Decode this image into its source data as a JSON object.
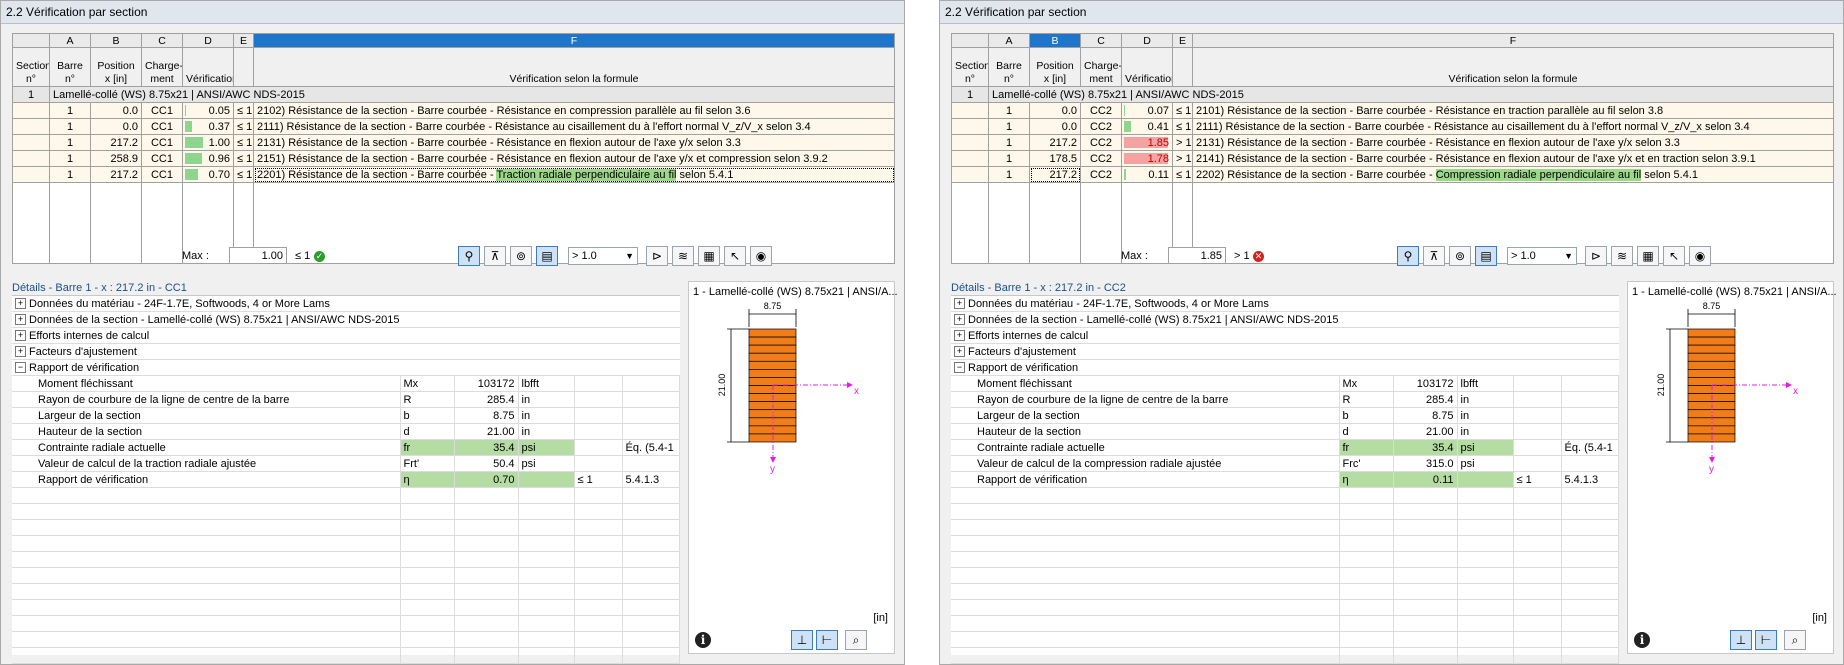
{
  "colors": {
    "selection": "#1f75c9",
    "ok_bar": "#8fd48f",
    "fail_bar": "#f4a3a3",
    "highlight": "#9bd889"
  },
  "columns": {
    "letters": [
      "A",
      "B",
      "C",
      "D",
      "E",
      "F"
    ],
    "section": "Section n°",
    "barre": "Barre n°",
    "position": "Position x [in]",
    "chargement": "Charge- ment",
    "verification": "Vérification",
    "formule": "Vérification selon la formule"
  },
  "window_a": {
    "title": "2.2  Vérification par section",
    "group": {
      "num": "1",
      "label": "Lamellé-collé (WS) 8.75x21 | ANSI/AWC NDS-2015"
    },
    "rows": [
      {
        "barre": "1",
        "x": "0.0",
        "load": "CC1",
        "ratio": 0.05,
        "ratio_text": "0.05",
        "le": "≤ 1",
        "text": "2102) Résistance de la section - Barre courbée - Résistance en compression parallèle au fil selon 3.6",
        "hl_pre": "",
        "hl": "",
        "hl_post": ""
      },
      {
        "barre": "1",
        "x": "0.0",
        "load": "CC1",
        "ratio": 0.37,
        "ratio_text": "0.37",
        "le": "≤ 1",
        "text": "2111) Résistance de la section - Barre courbée - Résistance au cisaillement du à l'effort normal V_z/V_x selon 3.4",
        "hl_pre": "",
        "hl": "",
        "hl_post": ""
      },
      {
        "barre": "1",
        "x": "217.2",
        "load": "CC1",
        "ratio": 1.0,
        "ratio_text": "1.00",
        "le": "≤ 1",
        "text": "2131) Résistance de la section - Barre courbée - Résistance en flexion autour de l'axe y/x selon 3.3",
        "hl_pre": "",
        "hl": "",
        "hl_post": ""
      },
      {
        "barre": "1",
        "x": "258.9",
        "load": "CC1",
        "ratio": 0.96,
        "ratio_text": "0.96",
        "le": "≤ 1",
        "text": "2151) Résistance de la section - Barre courbée - Résistance en flexion autour de l'axe y/x et compression selon 3.9.2",
        "hl_pre": "",
        "hl": "",
        "hl_post": ""
      },
      {
        "barre": "1",
        "x": "217.2",
        "load": "CC1",
        "ratio": 0.7,
        "ratio_text": "0.70",
        "le": "≤ 1",
        "text": "",
        "hl_pre": "2201) Résistance de la section - Barre courbée - ",
        "hl": "Traction radiale perpendiculaire au fil",
        "hl_post": " selon 5.4.1"
      }
    ],
    "max_label": "Max :",
    "max_value": "1.00",
    "max_cmp": "≤ 1",
    "filter": "> 1.0",
    "details_title": "Détails - Barre 1 - x : 217.2 in - CC1",
    "sections": [
      {
        "sign": "+",
        "label": "Données du matériau - 24F-1.7E, Softwoods, 4 or More Lams"
      },
      {
        "sign": "+",
        "label": "Données de la section - Lamellé-collé (WS) 8.75x21 | ANSI/AWC NDS-2015"
      },
      {
        "sign": "+",
        "label": "Efforts internes de calcul"
      },
      {
        "sign": "+",
        "label": "Facteurs d'ajustement"
      },
      {
        "sign": "−",
        "label": "Rapport de vérification"
      }
    ],
    "details": [
      {
        "name": "Moment fléchissant",
        "sym": "Mx",
        "val": "103172",
        "unit": "lbfft",
        "cmp": "",
        "ref": ""
      },
      {
        "name": "Rayon de courbure de la ligne de centre de la barre",
        "sym": "R",
        "val": "285.4",
        "unit": "in",
        "cmp": "",
        "ref": ""
      },
      {
        "name": "Largeur de la section",
        "sym": "b",
        "val": "8.75",
        "unit": "in",
        "cmp": "",
        "ref": ""
      },
      {
        "name": "Hauteur de la section",
        "sym": "d",
        "val": "21.00",
        "unit": "in",
        "cmp": "",
        "ref": ""
      },
      {
        "name": "Contrainte radiale actuelle",
        "sym": "fr",
        "val": "35.4",
        "unit": "psi",
        "cmp": "",
        "ref": "Éq. (5.4-1"
      },
      {
        "name": "Valeur de calcul de la traction radiale ajustée",
        "sym": "Frt'",
        "val": "50.4",
        "unit": "psi",
        "cmp": "",
        "ref": ""
      },
      {
        "name": "Rapport de vérification",
        "sym": "η",
        "val": "0.70",
        "unit": "",
        "cmp": "≤ 1",
        "ref": "5.4.1.3"
      }
    ],
    "preview_title": "1 - Lamellé-collé (WS) 8.75x21 | ANSI/A...",
    "dim_width": "8.75",
    "dim_height": "21.00",
    "axis_y": "y",
    "axis_x": "x",
    "unit": "[in]"
  },
  "window_b": {
    "title": "2.2  Vérification par section",
    "group": {
      "num": "1",
      "label": "Lamellé-collé (WS) 8.75x21 | ANSI/AWC NDS-2015"
    },
    "rows": [
      {
        "barre": "1",
        "x": "0.0",
        "load": "CC2",
        "ratio": 0.07,
        "ratio_text": "0.07",
        "le": "≤ 1",
        "text": "2101) Résistance de la section - Barre courbée - Résistance en traction parallèle au fil selon 3.8",
        "hl_pre": "",
        "hl": "",
        "hl_post": ""
      },
      {
        "barre": "1",
        "x": "0.0",
        "load": "CC2",
        "ratio": 0.41,
        "ratio_text": "0.41",
        "le": "≤ 1",
        "text": "2111) Résistance de la section - Barre courbée - Résistance au cisaillement du à l'effort normal V_z/V_x selon 3.4",
        "hl_pre": "",
        "hl": "",
        "hl_post": ""
      },
      {
        "barre": "1",
        "x": "217.2",
        "load": "CC2",
        "ratio": 1.85,
        "ratio_text": "1.85",
        "le": "> 1",
        "text": "2131) Résistance de la section - Barre courbée - Résistance en flexion autour de l'axe y/x selon 3.3",
        "hl_pre": "",
        "hl": "",
        "hl_post": ""
      },
      {
        "barre": "1",
        "x": "178.5",
        "load": "CC2",
        "ratio": 1.78,
        "ratio_text": "1.78",
        "le": "> 1",
        "text": "2141) Résistance de la section - Barre courbée - Résistance en flexion autour de l'axe y/x et en traction selon 3.9.1",
        "hl_pre": "",
        "hl": "",
        "hl_post": ""
      },
      {
        "barre": "1",
        "x": "217.2",
        "load": "CC2",
        "ratio": 0.11,
        "ratio_text": "0.11",
        "le": "≤ 1",
        "text": "",
        "hl_pre": "2202) Résistance de la section - Barre courbée - ",
        "hl": "Compression radiale perpendiculaire au fil",
        "hl_post": " selon 5.4.1"
      }
    ],
    "max_label": "Max :",
    "max_value": "1.85",
    "max_cmp": "> 1",
    "filter": "> 1.0",
    "details_title": "Détails - Barre 1 - x : 217.2 in - CC2",
    "sections": [
      {
        "sign": "+",
        "label": "Données du matériau - 24F-1.7E, Softwoods, 4 or More Lams"
      },
      {
        "sign": "+",
        "label": "Données de la section - Lamellé-collé (WS) 8.75x21 | ANSI/AWC NDS-2015"
      },
      {
        "sign": "+",
        "label": "Efforts internes de calcul"
      },
      {
        "sign": "+",
        "label": "Facteurs d'ajustement"
      },
      {
        "sign": "−",
        "label": "Rapport de vérification"
      }
    ],
    "details": [
      {
        "name": "Moment fléchissant",
        "sym": "Mx",
        "val": "103172",
        "unit": "lbfft",
        "cmp": "",
        "ref": ""
      },
      {
        "name": "Rayon de courbure de la ligne de centre de la barre",
        "sym": "R",
        "val": "285.4",
        "unit": "in",
        "cmp": "",
        "ref": ""
      },
      {
        "name": "Largeur de la section",
        "sym": "b",
        "val": "8.75",
        "unit": "in",
        "cmp": "",
        "ref": ""
      },
      {
        "name": "Hauteur de la section",
        "sym": "d",
        "val": "21.00",
        "unit": "in",
        "cmp": "",
        "ref": ""
      },
      {
        "name": "Contrainte radiale actuelle",
        "sym": "fr",
        "val": "35.4",
        "unit": "psi",
        "cmp": "",
        "ref": "Éq. (5.4-1"
      },
      {
        "name": "Valeur de calcul de la compression radiale ajustée",
        "sym": "Frc'",
        "val": "315.0",
        "unit": "psi",
        "cmp": "",
        "ref": ""
      },
      {
        "name": "Rapport de vérification",
        "sym": "η",
        "val": "0.11",
        "unit": "",
        "cmp": "≤ 1",
        "ref": "5.4.1.3"
      }
    ],
    "preview_title": "1 - Lamellé-collé (WS) 8.75x21 | ANSI/A...",
    "dim_width": "8.75",
    "dim_height": "21.00",
    "axis_y": "y",
    "axis_x": "x",
    "unit": "[in]"
  }
}
